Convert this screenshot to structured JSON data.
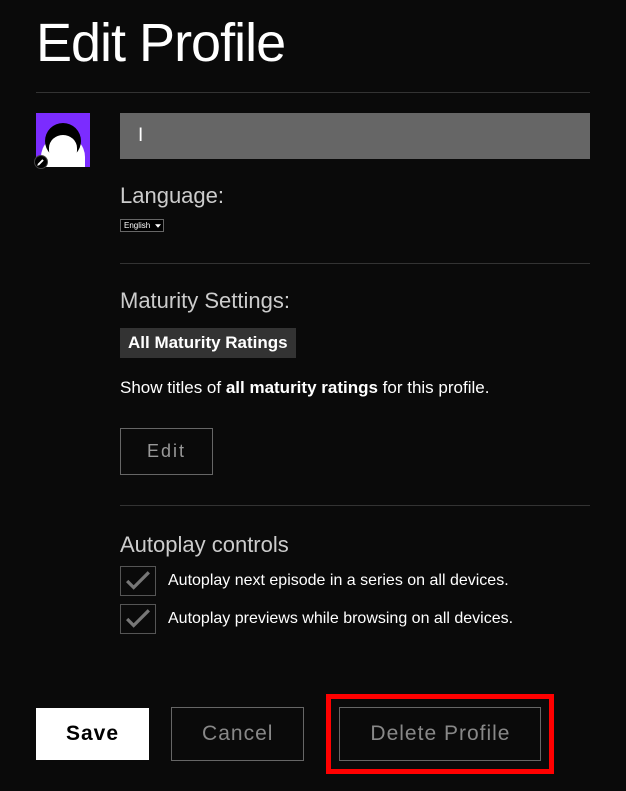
{
  "title": "Edit Profile",
  "profile": {
    "name": "I"
  },
  "language": {
    "label": "Language:",
    "selected": "English"
  },
  "maturity": {
    "heading": "Maturity Settings:",
    "badge": "All Maturity Ratings",
    "desc_pre": "Show titles of ",
    "desc_bold": "all maturity ratings",
    "desc_post": " for this profile.",
    "edit_label": "Edit"
  },
  "autoplay": {
    "heading": "Autoplay controls",
    "opt1": "Autoplay next episode in a series on all devices.",
    "opt2": "Autoplay previews while browsing on all devices."
  },
  "footer": {
    "save": "Save",
    "cancel": "Cancel",
    "delete": "Delete Profile"
  }
}
